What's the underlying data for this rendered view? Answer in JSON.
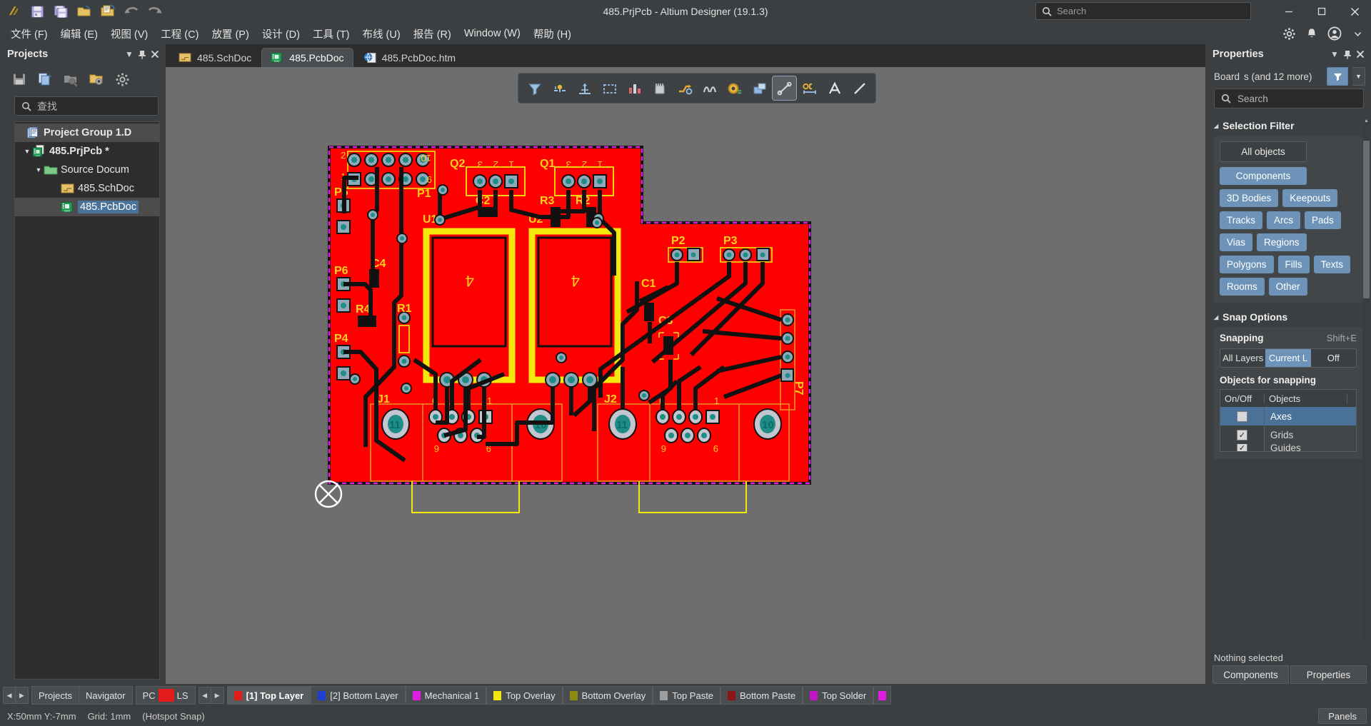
{
  "titlebar": {
    "title": "485.PrjPcb - Altium Designer (19.1.3)",
    "search_placeholder": "Search",
    "quick_tools": [
      "altium-logo-icon",
      "save-icon",
      "save-all-icon",
      "open-folder-icon",
      "open-document-icon",
      "undo-icon",
      "redo-icon"
    ],
    "window_buttons": [
      "minimize",
      "maximize",
      "close"
    ]
  },
  "menubar": {
    "items": [
      {
        "label": "文件 (F)"
      },
      {
        "label": "编辑 (E)"
      },
      {
        "label": "视图 (V)"
      },
      {
        "label": "工程 (C)"
      },
      {
        "label": "放置 (P)"
      },
      {
        "label": "设计 (D)"
      },
      {
        "label": "工具 (T)"
      },
      {
        "label": "布线 (U)"
      },
      {
        "label": "报告 (R)"
      },
      {
        "label": "Window (W)"
      },
      {
        "label": "帮助 (H)"
      }
    ],
    "right_icons": [
      "gear-icon",
      "bell-icon",
      "user-account-icon",
      "chevron-down-icon"
    ]
  },
  "projects_panel": {
    "title": "Projects",
    "header_buttons": [
      "chevron-down-icon",
      "pin-icon",
      "close-icon"
    ],
    "toolbar_icons": [
      "save-project-icon",
      "compile-document-icon",
      "open-project-search-icon",
      "project-options-icon",
      "settings-icon"
    ],
    "search_placeholder": "查找",
    "tree": [
      {
        "label": "Project Group 1.D",
        "icon": "project-group-icon",
        "level": 0,
        "bold": true,
        "selected": true,
        "arrow": ""
      },
      {
        "label": "485.PrjPcb *",
        "icon": "pcb-project-icon",
        "level": 1,
        "bold": true,
        "selected": false,
        "arrow": "▼"
      },
      {
        "label": "Source Docum",
        "icon": "folder-icon",
        "level": 2,
        "bold": false,
        "selected": false,
        "arrow": "▼"
      },
      {
        "label": "485.SchDoc",
        "icon": "schematic-doc-icon",
        "level": 3,
        "bold": false,
        "selected": false,
        "arrow": ""
      },
      {
        "label": "485.PcbDoc",
        "icon": "pcb-doc-icon",
        "level": 3,
        "bold": false,
        "selected": true,
        "arrow": ""
      }
    ]
  },
  "document_tabs": [
    {
      "label": "485.SchDoc",
      "icon": "schematic-doc-icon",
      "active": false
    },
    {
      "label": "485.PcbDoc",
      "icon": "pcb-doc-icon",
      "active": true
    },
    {
      "label": "485.PcbDoc.htm",
      "icon": "html-doc-icon",
      "active": false
    }
  ],
  "pcb_toolbar": {
    "buttons": [
      {
        "name": "selection-filter-icon",
        "selected": false
      },
      {
        "name": "cross-probe-icon",
        "selected": false
      },
      {
        "name": "origin-axis-icon",
        "selected": false
      },
      {
        "name": "area-select-icon",
        "selected": false
      },
      {
        "name": "place-component-icon",
        "selected": false
      },
      {
        "name": "place-ic-icon",
        "selected": false
      },
      {
        "name": "interactive-routing-icon",
        "selected": false
      },
      {
        "name": "differential-pair-routing-icon",
        "selected": false
      },
      {
        "name": "place-via-icon",
        "selected": false
      },
      {
        "name": "place-polygon-icon",
        "selected": false
      },
      {
        "name": "measure-distance-icon",
        "selected": true
      },
      {
        "name": "place-dimension-icon",
        "selected": false
      },
      {
        "name": "place-string-icon",
        "selected": false
      },
      {
        "name": "place-line-icon",
        "selected": false
      }
    ]
  },
  "properties_panel": {
    "title": "Properties",
    "header_buttons": [
      "chevron-down-icon",
      "pin-icon",
      "close-icon"
    ],
    "board_label": "Board",
    "board_value": "s (and 12 more)",
    "filter_icon": "funnel-icon",
    "search_placeholder": "Search",
    "selection_filter": {
      "title": "Selection Filter",
      "all_objects": "All objects",
      "chips": [
        "Components",
        "3D Bodies",
        "Keepouts",
        "Tracks",
        "Arcs",
        "Pads",
        "Vias",
        "Regions",
        "Polygons",
        "Fills",
        "Texts",
        "Rooms",
        "Other"
      ]
    },
    "snap_options": {
      "title": "Snap Options",
      "snapping_label": "Snapping",
      "snapping_shortcut": "Shift+E",
      "segments": [
        {
          "label": "All Layers",
          "on": false
        },
        {
          "label": "Current L",
          "on": true
        },
        {
          "label": "Off",
          "on": false
        }
      ],
      "objects_for_snapping_label": "Objects for snapping",
      "table_headers": [
        "On/Off",
        "Objects",
        ""
      ],
      "rows": [
        {
          "object": "Axes",
          "checked": false,
          "selected": true
        },
        {
          "object": "Grids",
          "checked": true,
          "selected": false
        },
        {
          "object": "Guides",
          "checked": true,
          "selected": false
        }
      ]
    },
    "status_text": "Nothing selected",
    "bottom_tabs": [
      "Components",
      "Properties"
    ]
  },
  "layer_bar": {
    "nav_left": "◀",
    "nav_right": "▶",
    "panel_tabs": [
      "Projects",
      "Navigator"
    ],
    "pcb_label": "PC",
    "ls_label": "LS",
    "ls_color": "#e21b1b",
    "layers": [
      {
        "label": "[1] Top Layer",
        "color": "#e21b1b",
        "active": true
      },
      {
        "label": "[2] Bottom Layer",
        "color": "#1f3fd1",
        "active": false
      },
      {
        "label": "Mechanical 1",
        "color": "#e21be2",
        "active": false
      },
      {
        "label": "Top Overlay",
        "color": "#f2e80c",
        "active": false
      },
      {
        "label": "Bottom Overlay",
        "color": "#8c8c14",
        "active": false
      },
      {
        "label": "Top Paste",
        "color": "#9e9e9e",
        "active": false
      },
      {
        "label": "Bottom Paste",
        "color": "#8c1414",
        "active": false
      },
      {
        "label": "Top Solder",
        "color": "#c415c4",
        "active": false
      },
      {
        "label": "",
        "color": "#e21be2",
        "active": false
      }
    ]
  },
  "statusbar": {
    "coords": "X:50mm Y:-7mm",
    "grid": "Grid: 1mm",
    "snap_mode": "(Hotspot Snap)",
    "panels_button": "Panels"
  },
  "pcb_canvas": {
    "designators": [
      "10",
      "2",
      "1",
      "9",
      "P1",
      "P5",
      "P6",
      "P4",
      "C4",
      "R4",
      "R1",
      "U1",
      "U2",
      "C2",
      "R3",
      "R2",
      "Q2",
      "Q1",
      "3",
      "2",
      "1",
      "C1",
      "C3",
      "P2",
      "P3",
      "P7",
      "J1",
      "J2",
      "6",
      "9",
      "11",
      "10"
    ],
    "board_color": "#ff0000",
    "outline_color": "#e21be2",
    "overlay_color": "#f2e80c",
    "origin_marker": "crosshair-circle"
  }
}
